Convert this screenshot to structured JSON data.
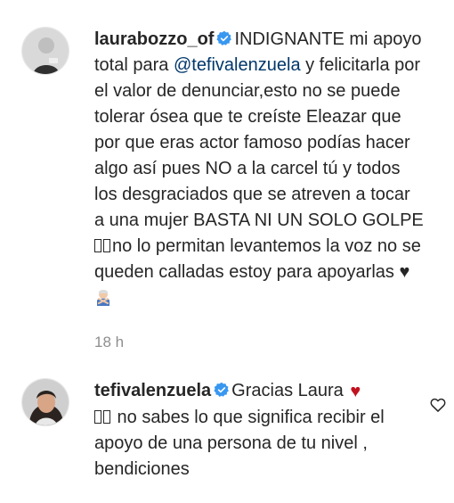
{
  "comments": [
    {
      "username": "laurabozzo_of",
      "verified": true,
      "text_1": "INDIGNANTE mi apoyo total para ",
      "mention": "@tefivalenzuela",
      "text_2": " y felicitarla por el valor de denunciar,esto no se puede tolerar ósea que te creíste Eleazar que por que eras actor famoso podías hacer algo así pues NO a la carcel tú y todos los desgraciados que se atreven a tocar a una mujer BASTA NI UN SOLO GOLPE ",
      "text_3": "no lo permitan levantemos la voz no se queden calladas estoy para apoyarlas ",
      "heart_emoji": "♥",
      "person_emoji": "person-gesturing-no-emoji",
      "timestamp": "18 h"
    },
    {
      "username": "tefivalenzuela",
      "verified": true,
      "text_1": "Gracias Laura ",
      "heart_emoji": "♥",
      "text_2": " no sabes lo que significa recibir el apoyo de una persona de tu nivel , bendiciones",
      "like_icon": "heart-outline-icon"
    }
  ],
  "colors": {
    "text": "#262626",
    "mention": "#00376b",
    "verified": "#3897f0",
    "muted": "#8e8e8e",
    "heart_red": "#c1121f"
  }
}
